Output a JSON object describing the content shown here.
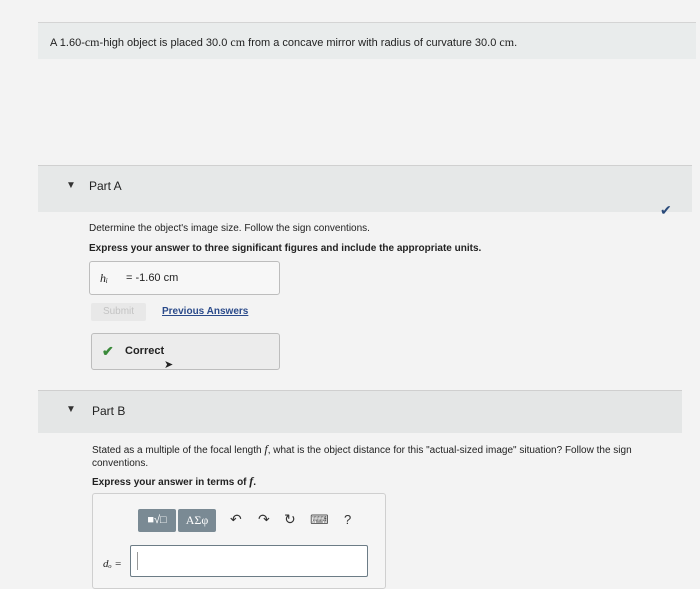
{
  "problem": {
    "text_before": "A 1.60-",
    "unit1": "cm",
    "text_mid1": "-high object is placed 30.0 ",
    "unit2": "cm",
    "text_mid2": " from a concave mirror with radius of curvature 30.0 ",
    "unit3": "cm",
    "text_end": "."
  },
  "partA": {
    "title": "Part A",
    "caret_icon": "▼",
    "status_icon": "✔",
    "question": "Determine the object's image size. Follow the sign conventions.",
    "instruction": "Express your answer to three significant figures and include the appropriate units.",
    "answer_var": "hᵢ",
    "answer_value": "=  -1.60 cm",
    "submit_label": "Submit",
    "previous_answers_label": "Previous Answers",
    "feedback_icon": "✔",
    "feedback_label": "Correct"
  },
  "partB": {
    "title": "Part B",
    "caret_icon": "▼",
    "question_pre": "Stated as a multiple of the focal length ",
    "question_var": "f",
    "question_post": ", what is the object distance for this \"actual-sized image\" situation? Follow the sign conventions.",
    "instruction_pre": "Express your answer in terms of ",
    "instruction_var": "f",
    "instruction_post": ".",
    "toolbar": {
      "templates_label": "■√□",
      "greek_label": "ΑΣφ",
      "undo_icon": "↶",
      "redo_icon": "↷",
      "reset_icon": "↻",
      "keyboard_icon": "⌨",
      "help_label": "?"
    },
    "input_label": "dₒ =",
    "input_value": ""
  }
}
